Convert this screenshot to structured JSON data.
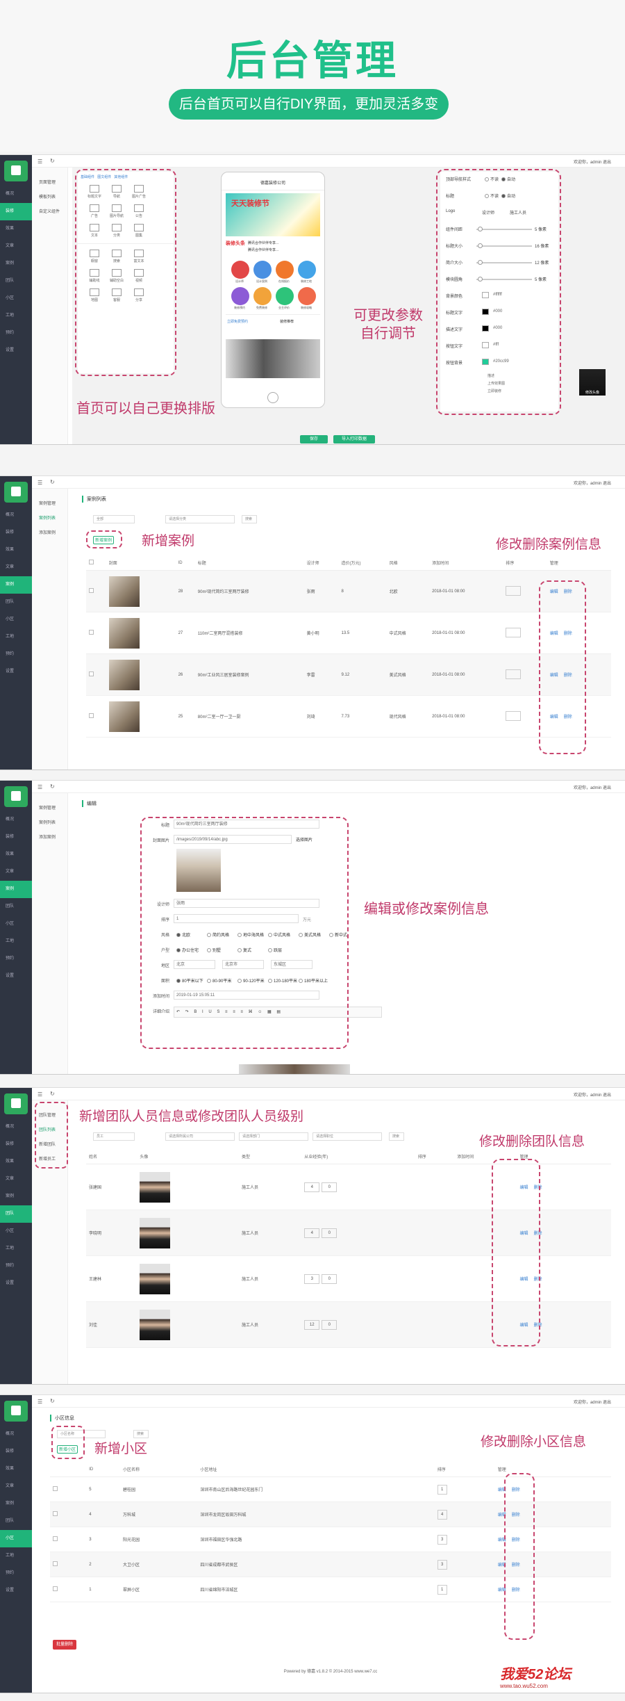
{
  "hero": {
    "title": "后台管理",
    "subtitle": "后台首页可以自行DIY界面，更加灵活多变"
  },
  "common": {
    "welcome": "欢迎你，admin",
    "logout": "退出",
    "sidebar": [
      "概况",
      "装修",
      "效果",
      "文章",
      "案例",
      "团队",
      "小区",
      "工地",
      "预约",
      "设置"
    ]
  },
  "panel1": {
    "subnav": [
      "页面管理",
      "模板列表",
      "自定义组件"
    ],
    "module_header": [
      "基础组件",
      "图文组件",
      "其他组件"
    ],
    "modules_basic": [
      "标题文字",
      "导航",
      "图片广告",
      "广告",
      "图片导航",
      "公告",
      "文本",
      "分类",
      "图集"
    ],
    "modules_more": [
      "橱窗",
      "搜索",
      "富文本",
      "辅助线",
      "辅助空白",
      "视频",
      "地图",
      "客服",
      "分享"
    ],
    "phone": {
      "shop_name": "德嘉装修公司",
      "banner_text": "天天装修节",
      "banner_sub": "装修头条",
      "news1": "腾讯合作伙伴专享...",
      "news2": "腾讯合作伙伴专享...",
      "icons": [
        "设计师",
        "设计案例",
        "在线报价",
        "装修工地",
        "装修预约",
        "免费装修",
        "业主评价",
        "装修攻略"
      ],
      "promo1": "立即免费预约",
      "promo2": "装修推荐"
    },
    "settings": {
      "rows": [
        "顶部导航样式",
        "标题",
        "Logo",
        "组件间距",
        "标题大小",
        "简介大小",
        "模块圆角",
        "背景颜色",
        "标题文字",
        "描述文字",
        "按钮文字",
        "按钮背景"
      ],
      "options": [
        "不读",
        "自动"
      ],
      "values": [
        "5 像素",
        "16 像素",
        "12 像素",
        "5 像素"
      ],
      "colors": [
        "#ffffff",
        "#000",
        "#000",
        "#fff",
        "#20cc99"
      ],
      "texts": [
        "设计师",
        "施工人员",
        "描述",
        "上传效果图",
        "立即装修"
      ]
    },
    "buttons": [
      "保存",
      "导入打印数据"
    ],
    "annotation_left": "首页可以自己更换排版",
    "annotation_right_1": "可更改参数",
    "annotation_right_2": "自行调节",
    "avatar_label": "修改头像"
  },
  "panel2": {
    "subnav": [
      "案例管理",
      "案例列表",
      "添加案例"
    ],
    "section": "案例列表",
    "filter_label": "全部",
    "filter_select": "请选择分类",
    "search_btn": "搜索",
    "add_btn": "新增案例",
    "headers": [
      "",
      "封面",
      "ID",
      "标题",
      "设计师",
      "造价(万元)",
      "风格",
      "添加时间",
      "排序",
      "管理"
    ],
    "rows": [
      {
        "id": "28",
        "title": "90m²现代简约三室两厅装修",
        "designer": "张雨",
        "cost": "8",
        "style": "北欧",
        "time": "2018-01-01 08:00"
      },
      {
        "id": "27",
        "title": "110m²二室两厅混搭装修",
        "designer": "黄小明",
        "cost": "13.5",
        "style": "中式风格",
        "time": "2018-01-01 08:00"
      },
      {
        "id": "26",
        "title": "90m²工业风三居室装修案例",
        "designer": "李雷",
        "cost": "9.12",
        "style": "美式风格",
        "time": "2018-01-01 08:00"
      },
      {
        "id": "25",
        "title": "80m²二室一厅一卫一厨",
        "designer": "刘琦",
        "cost": "7.73",
        "style": "现代风格",
        "time": "2018-01-01 08:00"
      }
    ],
    "actions": [
      "编辑",
      "删除"
    ],
    "annotation_add": "新增案例",
    "annotation_manage": "修改删除案例信息"
  },
  "panel3": {
    "subnav": [
      "案例管理",
      "案例列表",
      "添加案例"
    ],
    "section": "编辑",
    "labels": [
      "标题",
      "封面图片",
      "设计师",
      "排序",
      "风格",
      "户型",
      "地区",
      "面积",
      "添加时间",
      "详细介绍"
    ],
    "title_value": "90m²现代简约三室两厅装修",
    "cover_value": "/images/2019/09/14/abc.jpg",
    "choose_btn": "选择图片",
    "designer_value": "张雨",
    "order_value": "1",
    "order_unit": "万元",
    "styles": [
      "北欧",
      "简约风格",
      "地中海风格",
      "中式风格",
      "美式风格",
      "新中式"
    ],
    "layouts": [
      "办公住宅",
      "别墅",
      "复式",
      "跃层"
    ],
    "regions": [
      "北京",
      "北京市",
      "东城区"
    ],
    "areas": [
      "80平米以下",
      "80-90平米",
      "90-120平米",
      "120-180平米",
      "180平米以上"
    ],
    "time_value": "2019-01-19 15:05:11",
    "annotation": "编辑或修改案例信息"
  },
  "panel4": {
    "subnav": [
      "团队管理",
      "团队列表",
      "新增团队",
      "新增员工"
    ],
    "filters": [
      "员工",
      "请选择所属公司",
      "请选择部门",
      "请选择职位"
    ],
    "search_btn": "搜索",
    "headers": [
      "姓名",
      "头像",
      "类型",
      "从业经验(年)",
      "排序",
      "添加时间",
      "管理"
    ],
    "rows": [
      {
        "name": "张建国",
        "type": "施工人员",
        "exp": "4",
        "order": "0"
      },
      {
        "name": "李晓明",
        "type": "施工人员",
        "exp": "4",
        "order": "0"
      },
      {
        "name": "王建林",
        "type": "施工人员",
        "exp": "3",
        "order": "0"
      },
      {
        "name": "刘佳",
        "type": "施工人员",
        "exp": "12",
        "order": "0"
      }
    ],
    "actions": [
      "编辑",
      "删除"
    ],
    "annotation_top": "新增团队人员信息或修改团队人员级别",
    "annotation_manage": "修改删除团队信息"
  },
  "panel5": {
    "section": "小区信息",
    "search_placeholder": "小区名称",
    "search_btn": "搜索",
    "add_btn": "新增小区",
    "headers": [
      "",
      "ID",
      "小区名称",
      "小区地址",
      "排序",
      "管理"
    ],
    "rows": [
      {
        "id": "5",
        "name": "碧桂园",
        "addr": "深圳市南山区后海路世纪花园东门",
        "order": "1"
      },
      {
        "id": "4",
        "name": "万科城",
        "addr": "深圳市龙岗区坂田万科城",
        "order": "4"
      },
      {
        "id": "3",
        "name": "阳光花园",
        "addr": "深圳市福田区华强北路",
        "order": "3"
      },
      {
        "id": "2",
        "name": "大卫小区",
        "addr": "四川省成都市武侯区",
        "order": "3"
      },
      {
        "id": "1",
        "name": "翠屏小区",
        "addr": "四川省绵阳市涪城区",
        "order": "1"
      }
    ],
    "actions": [
      "编辑",
      "删除"
    ],
    "batch_delete": "批量删除",
    "footer": "Powered by 德嘉 v1.8.2 © 2014-2015 www.we7.cc",
    "annotation_add": "新增小区",
    "annotation_manage": "修改删除小区信息"
  },
  "watermark": {
    "text": "我爱52论坛",
    "url": "www.tao.wu52.com"
  }
}
